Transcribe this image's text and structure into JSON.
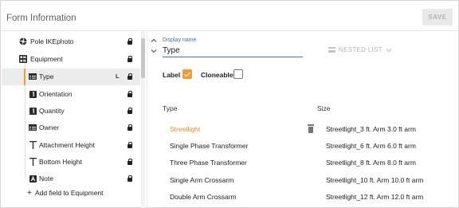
{
  "header": {
    "title": "Form Information",
    "save_label": "SAVE"
  },
  "sidebar": {
    "items": [
      {
        "label": "Pole IKEphoto",
        "icon": "aperture-icon"
      },
      {
        "label": "Equipment",
        "icon": "grid-icon"
      },
      {
        "label": "Type",
        "icon": "list-icon",
        "badge": "L",
        "active": true
      },
      {
        "label": "Orientation",
        "icon": "numeric-box-icon"
      },
      {
        "label": "Quantity",
        "icon": "numeric-box-icon"
      },
      {
        "label": "Owner",
        "icon": "list-icon"
      },
      {
        "label": "Attachment Height",
        "icon": "height-icon"
      },
      {
        "label": "Bottom Height",
        "icon": "height-icon"
      },
      {
        "label": "Note",
        "icon": "text-box-icon"
      }
    ],
    "add_field_label": "Add field to Equipment"
  },
  "editor": {
    "display_name_label": "Display name",
    "display_name_value": "Type",
    "nested_list_label": "NESTED LIST",
    "label_checkbox": {
      "label": "Label",
      "checked": true
    },
    "cloneable_checkbox": {
      "label": "Cloneable",
      "checked": false
    },
    "columns": {
      "type": "Type",
      "size": "Size"
    },
    "rows": [
      {
        "type": "Streetlight",
        "size": "Streetlight_3 ft. Arm 3.0 ft arm",
        "selected": true
      },
      {
        "type": "Single Phase Transformer",
        "size": "Streetlight_6 ft. Arm 6.0 ft arm"
      },
      {
        "type": "Three Phase Transformer",
        "size": "Streetlight_8 ft. Arm 8.0 ft arm"
      },
      {
        "type": "Single Arm Crossarm",
        "size": "Streetlight_10 ft. Arm 10.0 ft arm"
      },
      {
        "type": "Double Arm Crossarm",
        "size": "Streetlight_12 ft. Arm 12.0 ft arm"
      }
    ]
  },
  "colors": {
    "accent": "#f29b34",
    "link": "#4a6fa5",
    "selected_text": "#e8892b"
  }
}
